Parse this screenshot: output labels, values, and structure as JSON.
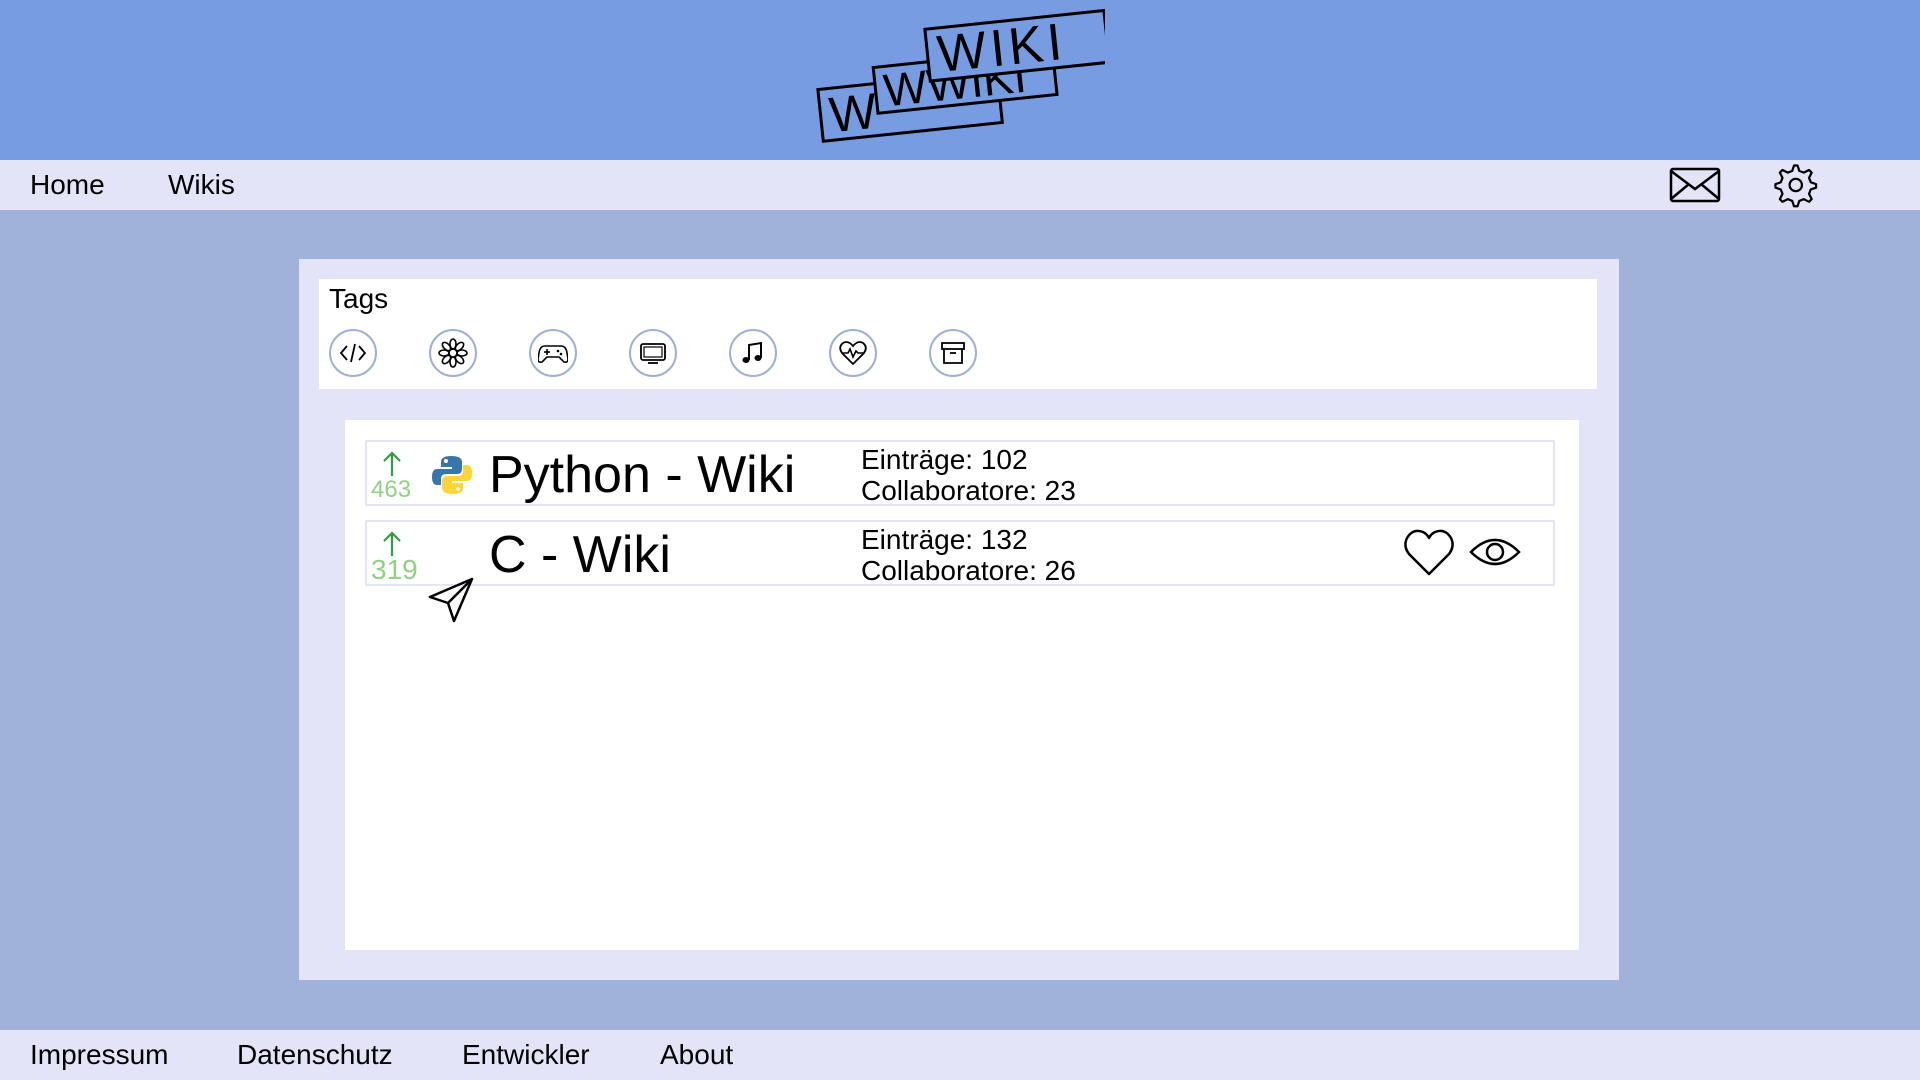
{
  "logo": {
    "text": "WIKI",
    "text_back": "WWIKI"
  },
  "nav": {
    "home": "Home",
    "wikis": "Wikis",
    "mail_icon": "mail-icon",
    "settings_icon": "gear-icon"
  },
  "tags": {
    "title": "Tags",
    "items": [
      "code-icon",
      "flower-icon",
      "gamepad-icon",
      "tv-icon",
      "music-icon",
      "heart-pulse-icon",
      "archive-icon"
    ]
  },
  "wikis": [
    {
      "votes": "463",
      "title": "Python - Wiki",
      "entries": "Einträge: 102",
      "collaborators": "Collaboratore: 23",
      "icon": "python-icon"
    },
    {
      "votes": "319",
      "title": "C - Wiki",
      "entries": "Einträge: 132",
      "collaborators": "Collaboratore: 26",
      "actions": [
        "heart-icon",
        "eye-icon"
      ]
    }
  ],
  "footer": {
    "impressum": "Impressum",
    "datenschutz": "Datenschutz",
    "entwickler": "Entwickler",
    "about": "About"
  },
  "colors": {
    "header": "#779ce2",
    "navbar": "#e3e4f8",
    "background": "#a0b2da",
    "vote": "#8fd283",
    "arrow": "#2e9e3e"
  }
}
